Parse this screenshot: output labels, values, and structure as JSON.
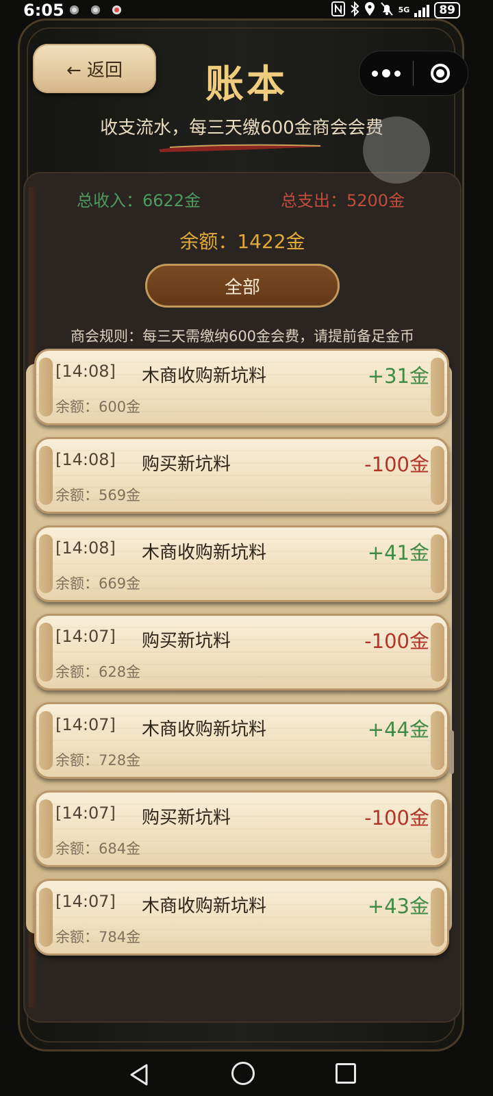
{
  "status_bar": {
    "time": "6:05",
    "network": "5G",
    "battery": "89"
  },
  "header": {
    "back_label": "← 返回",
    "title": "账本",
    "subtitle": "收支流水，每三天缴600金商会会费"
  },
  "summary": {
    "income": "总收入：6622金",
    "expense": "总支出：5200金",
    "balance": "余额：1422金",
    "filter_label": "全部",
    "rules": "商会规则：每三天需缴纳600金会费，请提前备足金币"
  },
  "entries": [
    {
      "time": "[14:08]",
      "desc": "木商收购新坑料",
      "amount": "+31金",
      "balance": "余额：600金"
    },
    {
      "time": "[14:08]",
      "desc": "购买新坑料",
      "amount": "-100金",
      "balance": "余额：569金"
    },
    {
      "time": "[14:08]",
      "desc": "木商收购新坑料",
      "amount": "+41金",
      "balance": "余额：669金"
    },
    {
      "time": "[14:07]",
      "desc": "购买新坑料",
      "amount": "-100金",
      "balance": "余额：628金"
    },
    {
      "time": "[14:07]",
      "desc": "木商收购新坑料",
      "amount": "+44金",
      "balance": "余额：728金"
    },
    {
      "time": "[14:07]",
      "desc": "购买新坑料",
      "amount": "-100金",
      "balance": "余额：684金"
    },
    {
      "time": "[14:07]",
      "desc": "木商收购新坑料",
      "amount": "+43金",
      "balance": "余额：784金"
    }
  ],
  "colors": {
    "title_gold": "#f0cd7e",
    "income_green": "#4f9a5e",
    "expense_red": "#c44c3c",
    "balance_gold": "#e0a93a",
    "plus_green": "#3f8a44",
    "minus_red": "#b33428"
  },
  "icons": [
    "notification-dot-icon",
    "nfc-icon",
    "bluetooth-icon",
    "location-icon",
    "mute-icon",
    "signal-icon",
    "battery-icon",
    "more-dots-icon",
    "close-circle-icon",
    "nav-back-icon",
    "nav-home-icon",
    "nav-recent-icon"
  ]
}
